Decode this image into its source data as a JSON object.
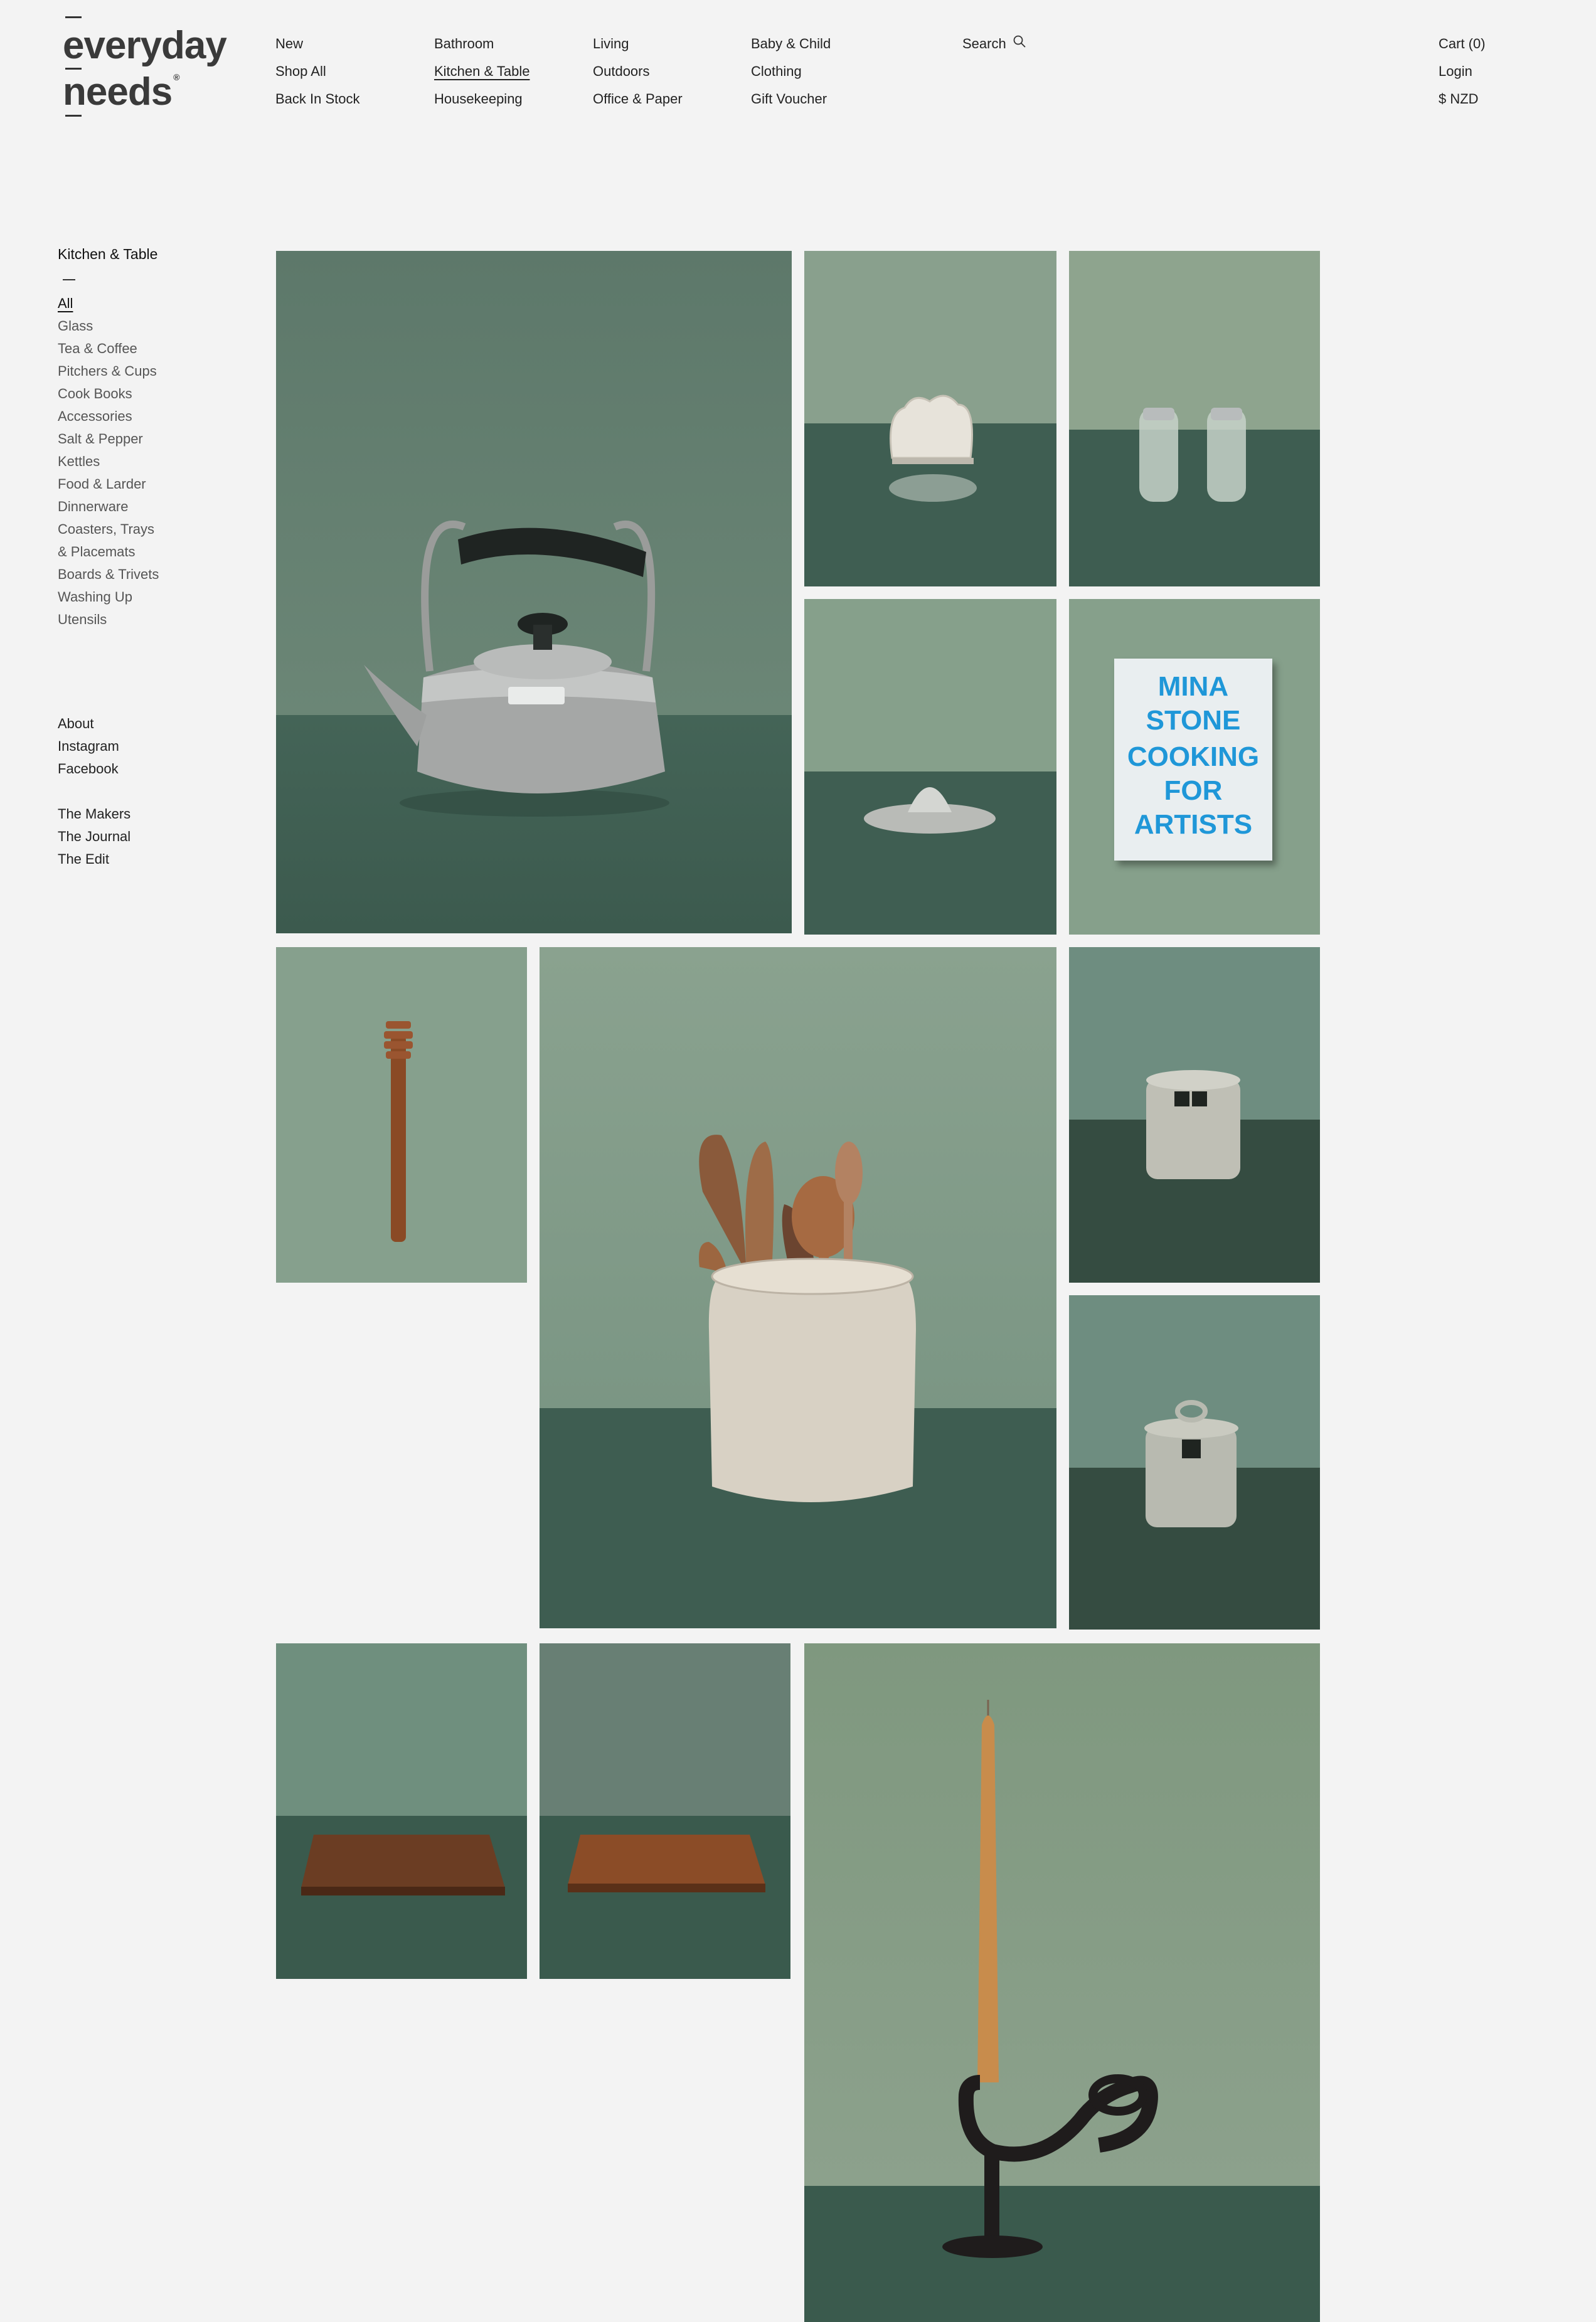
{
  "brand": {
    "line1": "everyday",
    "line2": "needs"
  },
  "nav": {
    "col1": [
      "New",
      "Shop All",
      "Back In Stock"
    ],
    "col2": [
      "Bathroom",
      "Kitchen & Table",
      "Housekeeping"
    ],
    "col3": [
      "Living",
      "Outdoors",
      "Office & Paper"
    ],
    "col4": [
      "Baby & Child",
      "Clothing",
      "Gift Voucher"
    ],
    "active": "Kitchen & Table"
  },
  "search": {
    "label": "Search"
  },
  "account": {
    "cart": "Cart (0)",
    "login": "Login",
    "currency": "$ NZD"
  },
  "sidebar": {
    "title": "Kitchen & Table",
    "categories": [
      "All",
      "Glass",
      "Tea & Coffee",
      "Pitchers & Cups",
      "Cook Books",
      "Accessories",
      "Salt & Pepper",
      "Kettles",
      "Food & Larder",
      "Dinnerware",
      "Coasters, Trays",
      "& Placemats",
      "Boards & Trivets",
      "Washing Up",
      "Utensils"
    ],
    "active_category": "All",
    "links_primary": [
      "About",
      "Instagram",
      "Facebook"
    ],
    "links_secondary": [
      "The Makers",
      "The Journal",
      "The Edit"
    ]
  },
  "products": {
    "book": {
      "lines": [
        "MINA",
        "STONE",
        "COOKING",
        "FOR",
        "ARTISTS"
      ]
    }
  },
  "colors": {
    "background": "#f3f3f3",
    "wall_green": "#7f9a86",
    "floor_green": "#3f5e52",
    "book_blue": "#1f97d8"
  }
}
